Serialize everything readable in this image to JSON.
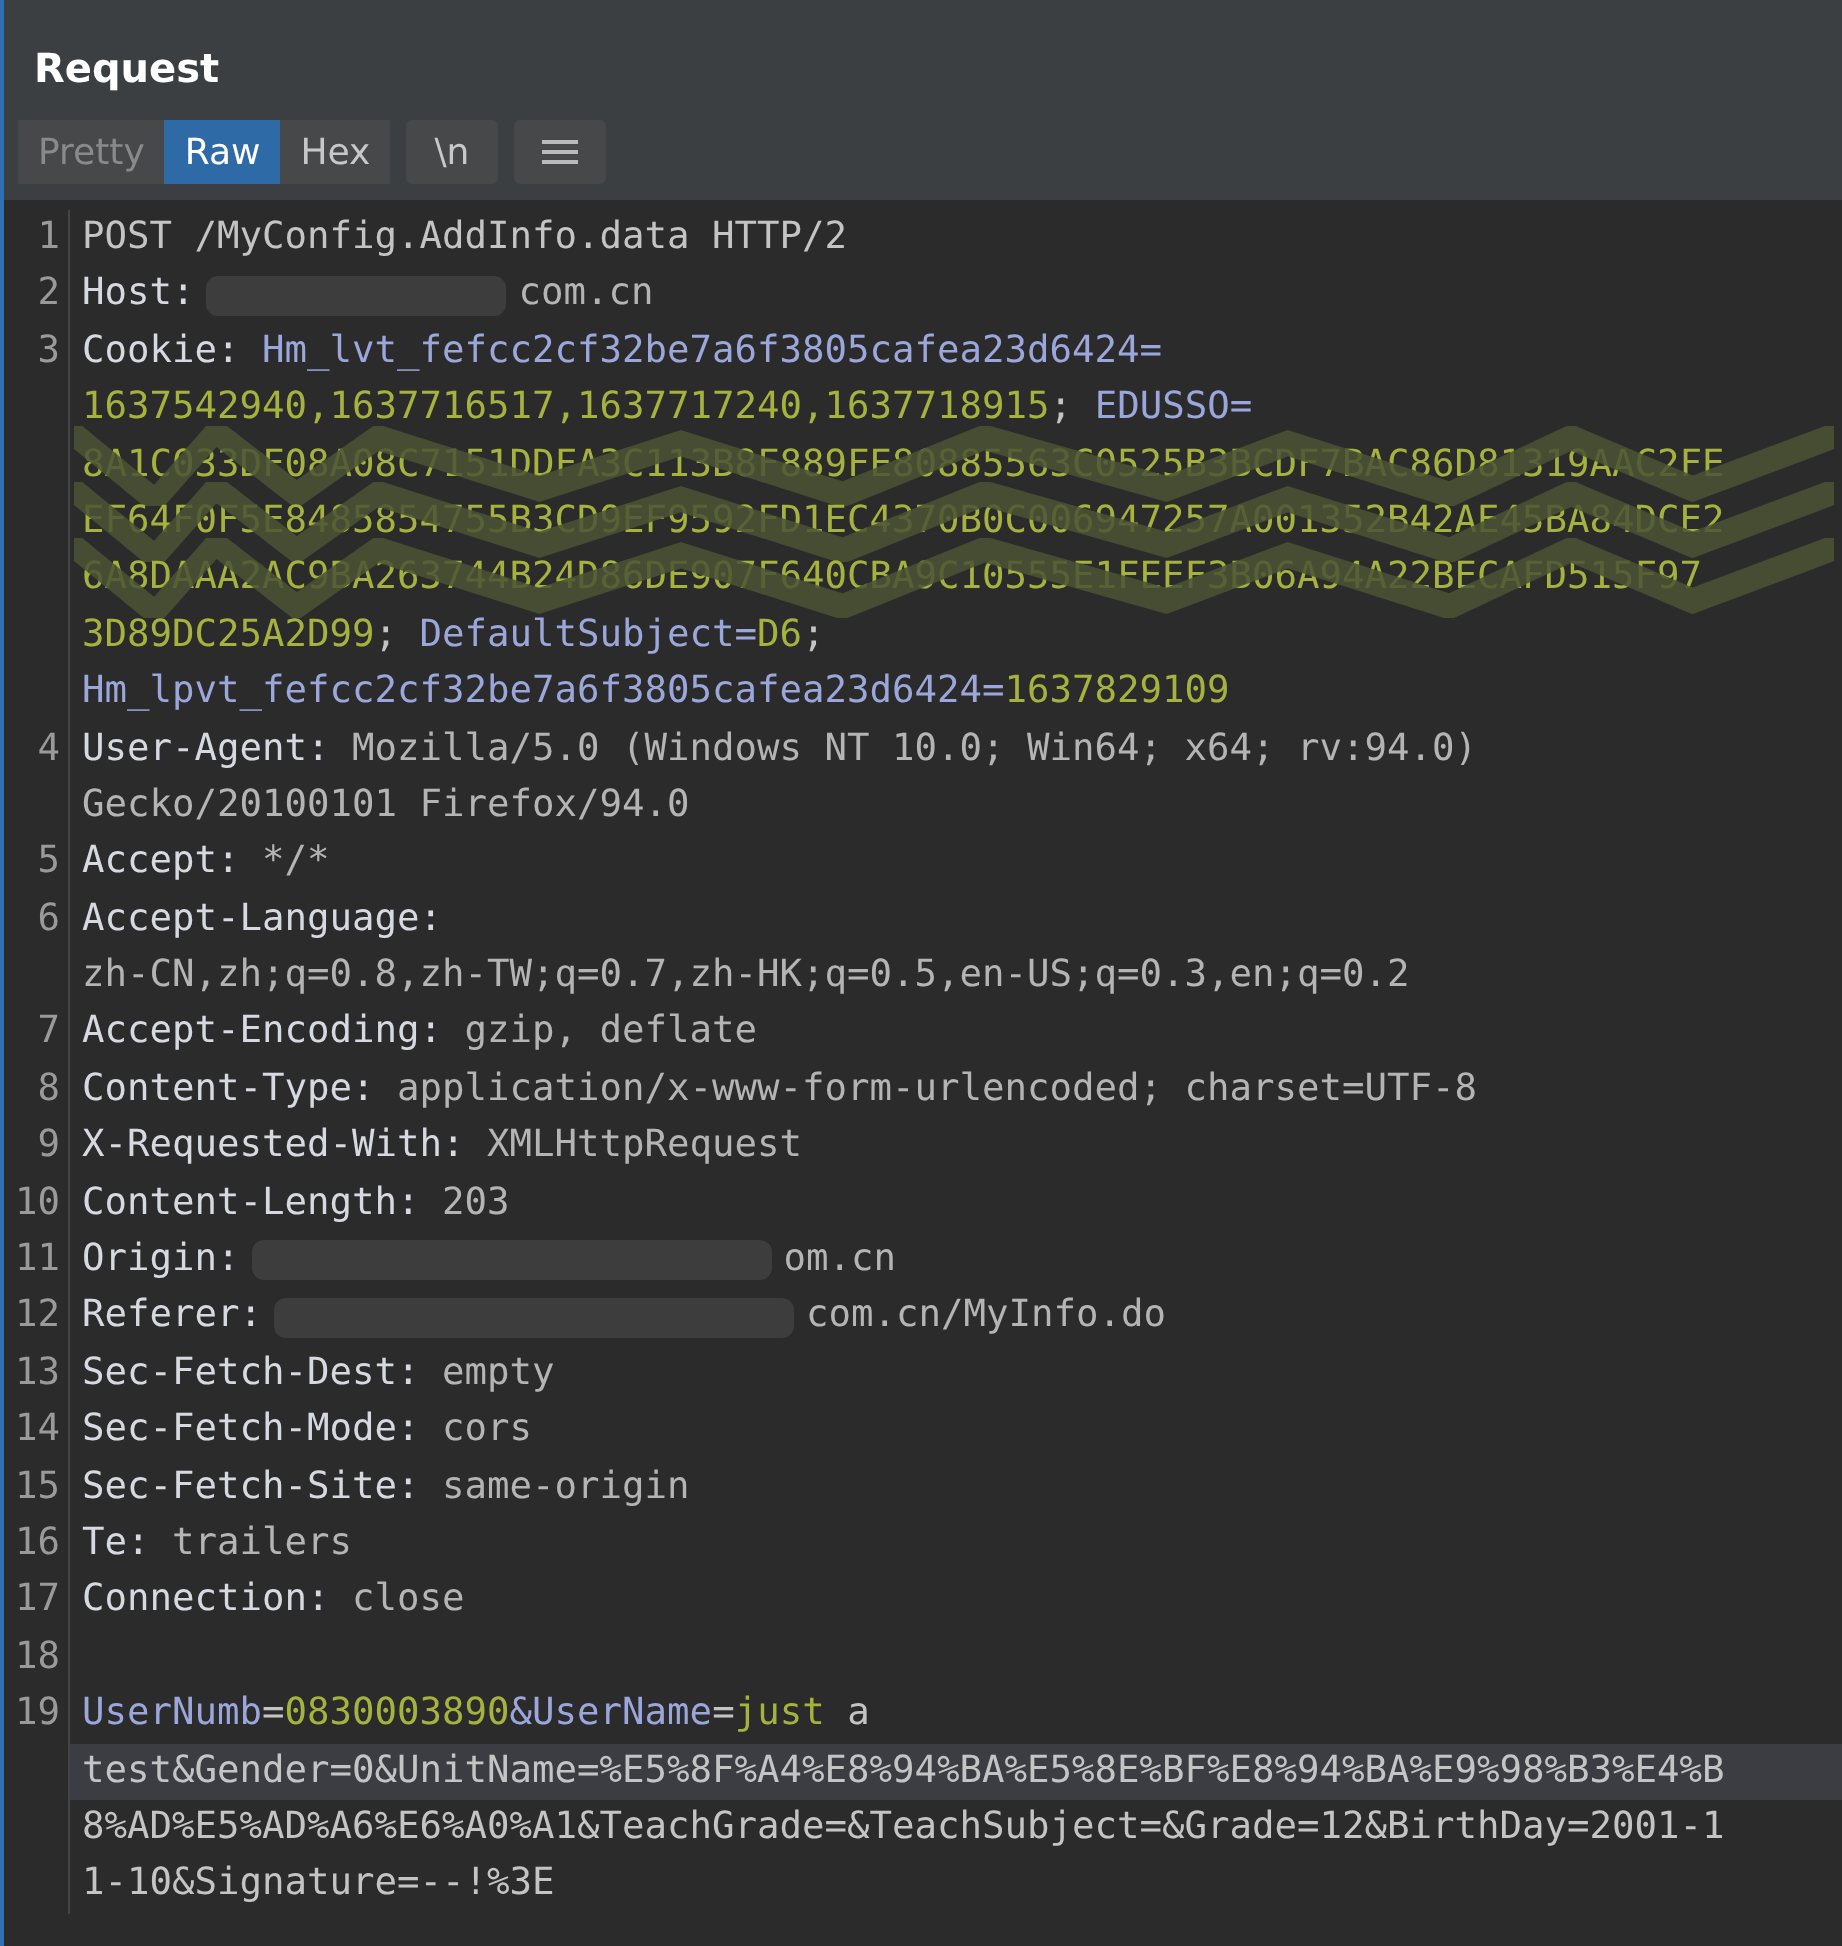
{
  "panel": {
    "title": "Request"
  },
  "tabs": [
    {
      "label": "Pretty",
      "selected": false,
      "disabled": true
    },
    {
      "label": "Raw",
      "selected": true,
      "disabled": false
    },
    {
      "label": "Hex",
      "selected": false,
      "disabled": false
    }
  ],
  "toolbar_buttons": [
    {
      "kind": "text",
      "label": "\\n"
    },
    {
      "kind": "menu"
    }
  ],
  "lines": [
    {
      "number": "1",
      "rows": [
        {
          "tokens": [
            {
              "kind": "plain",
              "text": "POST /MyConfig.AddInfo.data HTTP/2"
            }
          ]
        }
      ]
    },
    {
      "number": "2",
      "rows": [
        {
          "tokens": [
            {
              "kind": "head",
              "text": "Host:"
            },
            {
              "kind": "redacted-short"
            },
            {
              "kind": "hval",
              "text": "com.cn"
            }
          ]
        }
      ]
    },
    {
      "number": "3",
      "rows": [
        {
          "tokens": [
            {
              "kind": "head",
              "text": "Cookie: "
            },
            {
              "kind": "key",
              "text": "Hm_lvt_fefcc2cf32be7a6f3805cafea23d6424="
            }
          ]
        },
        {
          "tokens": [
            {
              "kind": "value",
              "text": "1637542940,1637716517,1637717240,1637718915"
            },
            {
              "kind": "plain",
              "text": "; "
            },
            {
              "kind": "key",
              "text": "EDUSSO="
            }
          ]
        },
        {
          "scribbled": true,
          "tokens": [
            {
              "kind": "value",
              "text": "8A1C033DF08A08C7151DDFA3C113B8F889FE80885563C0525B3BCDF7BAC86D81319AAC2FE"
            }
          ]
        },
        {
          "scribbled": true,
          "tokens": [
            {
              "kind": "value",
              "text": "EF64F0F5E8485854755B3CD9EF9592FD1EC4370B0C006947257A001352B42AE45BA84DCE2"
            }
          ]
        },
        {
          "scribbled": true,
          "tokens": [
            {
              "kind": "value",
              "text": "6A8DAAA2AC9BA263744B24D86DE907F640CBA9C10555E1FEEF3B06A94A22BECAFD515F97"
            }
          ]
        },
        {
          "tokens": [
            {
              "kind": "value",
              "text": "3D89DC25A2D99"
            },
            {
              "kind": "plain",
              "text": "; "
            },
            {
              "kind": "key",
              "text": "DefaultSubject="
            },
            {
              "kind": "value",
              "text": "D6"
            },
            {
              "kind": "plain",
              "text": ";"
            }
          ]
        },
        {
          "tokens": [
            {
              "kind": "key",
              "text": "Hm_lpvt_fefcc2cf32be7a6f3805cafea23d6424="
            },
            {
              "kind": "value",
              "text": "1637829109"
            }
          ]
        }
      ]
    },
    {
      "number": "4",
      "rows": [
        {
          "tokens": [
            {
              "kind": "head",
              "text": "User-Agent: "
            },
            {
              "kind": "hval",
              "text": "Mozilla/5.0 (Windows NT 10.0; Win64; x64; rv:94.0)"
            }
          ]
        },
        {
          "tokens": [
            {
              "kind": "hval",
              "text": "Gecko/20100101 Firefox/94.0"
            }
          ]
        }
      ]
    },
    {
      "number": "5",
      "rows": [
        {
          "tokens": [
            {
              "kind": "head",
              "text": "Accept: "
            },
            {
              "kind": "hval",
              "text": "*/*"
            }
          ]
        }
      ]
    },
    {
      "number": "6",
      "rows": [
        {
          "tokens": [
            {
              "kind": "head",
              "text": "Accept-Language:"
            }
          ]
        },
        {
          "tokens": [
            {
              "kind": "hval",
              "text": "zh-CN,zh;q=0.8,zh-TW;q=0.7,zh-HK;q=0.5,en-US;q=0.3,en;q=0.2"
            }
          ]
        }
      ]
    },
    {
      "number": "7",
      "rows": [
        {
          "tokens": [
            {
              "kind": "head",
              "text": "Accept-Encoding: "
            },
            {
              "kind": "hval",
              "text": "gzip, deflate"
            }
          ]
        }
      ]
    },
    {
      "number": "8",
      "rows": [
        {
          "tokens": [
            {
              "kind": "head",
              "text": "Content-Type: "
            },
            {
              "kind": "hval",
              "text": "application/x-www-form-urlencoded; charset=UTF-8"
            }
          ]
        }
      ]
    },
    {
      "number": "9",
      "rows": [
        {
          "tokens": [
            {
              "kind": "head",
              "text": "X-Requested-With: "
            },
            {
              "kind": "hval",
              "text": "XMLHttpRequest"
            }
          ]
        }
      ]
    },
    {
      "number": "10",
      "rows": [
        {
          "tokens": [
            {
              "kind": "head",
              "text": "Content-Length: "
            },
            {
              "kind": "hval",
              "text": "203"
            }
          ]
        }
      ]
    },
    {
      "number": "11",
      "rows": [
        {
          "tokens": [
            {
              "kind": "head",
              "text": "Origin:"
            },
            {
              "kind": "redacted-long"
            },
            {
              "kind": "hval",
              "text": "om.cn"
            }
          ]
        }
      ]
    },
    {
      "number": "12",
      "rows": [
        {
          "tokens": [
            {
              "kind": "head",
              "text": "Referer:"
            },
            {
              "kind": "redacted-long"
            },
            {
              "kind": "hval",
              "text": "com.cn/MyInfo.do"
            }
          ]
        }
      ]
    },
    {
      "number": "13",
      "rows": [
        {
          "tokens": [
            {
              "kind": "head",
              "text": "Sec-Fetch-Dest: "
            },
            {
              "kind": "hval",
              "text": "empty"
            }
          ]
        }
      ]
    },
    {
      "number": "14",
      "rows": [
        {
          "tokens": [
            {
              "kind": "head",
              "text": "Sec-Fetch-Mode: "
            },
            {
              "kind": "hval",
              "text": "cors"
            }
          ]
        }
      ]
    },
    {
      "number": "15",
      "rows": [
        {
          "tokens": [
            {
              "kind": "head",
              "text": "Sec-Fetch-Site: "
            },
            {
              "kind": "hval",
              "text": "same-origin"
            }
          ]
        }
      ]
    },
    {
      "number": "16",
      "rows": [
        {
          "tokens": [
            {
              "kind": "head",
              "text": "Te: "
            },
            {
              "kind": "hval",
              "text": "trailers"
            }
          ]
        }
      ]
    },
    {
      "number": "17",
      "rows": [
        {
          "tokens": [
            {
              "kind": "head",
              "text": "Connection: "
            },
            {
              "kind": "hval",
              "text": "close"
            }
          ]
        }
      ]
    },
    {
      "number": "18",
      "rows": [
        {
          "tokens": []
        }
      ]
    },
    {
      "number": "19",
      "rows": [
        {
          "tokens": [
            {
              "kind": "key",
              "text": "UserNumb"
            },
            {
              "kind": "plain",
              "text": "="
            },
            {
              "kind": "value",
              "text": "0830003890"
            },
            {
              "kind": "key",
              "text": "&UserName"
            },
            {
              "kind": "plain",
              "text": "="
            },
            {
              "kind": "value",
              "text": "just"
            },
            {
              "kind": "plain",
              "text": " a"
            }
          ]
        },
        {
          "highlighted": true,
          "tokens": [
            {
              "kind": "plain",
              "text": "test&Gender=0&UnitName=%E5%8F%A4%E8%94%BA%E5%8E%BF%E8%94%BA%E9%98%B3%E4%B"
            }
          ]
        },
        {
          "tokens": [
            {
              "kind": "plain",
              "text": "8%AD%E5%AD%A6%E6%A0%A1&TeachGrade=&TeachSubject=&Grade=12&BirthDay=2001-1"
            }
          ]
        },
        {
          "tokens": [
            {
              "kind": "plain",
              "text": "1-10&Signature=--!%3E"
            }
          ]
        }
      ]
    }
  ]
}
